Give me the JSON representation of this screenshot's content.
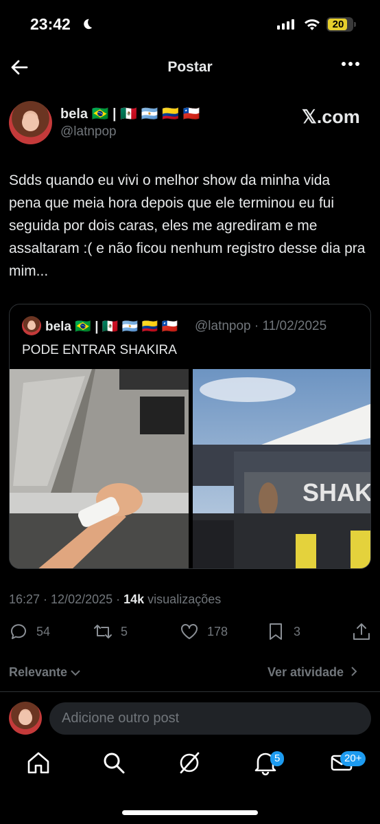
{
  "status_bar": {
    "time": "23:42",
    "battery": "20"
  },
  "header": {
    "title": "Postar"
  },
  "post": {
    "author_name": "bela 🇧🇷 | 🇲🇽 🇦🇷 🇨🇴 🇨🇱",
    "author_handle": "@latnpop",
    "source_badge": "𝕏.com",
    "text": "Sdds quando eu vivi o melhor show da minha vida pena que meia hora depois que ele terminou eu fui seguida por dois caras, eles me agrediram e me assaltaram :( e não ficou nenhum registro desse dia pra mim...",
    "timestamp": "16:27 · 12/02/2025 · ",
    "views_count": "14k",
    "views_label": " visualizações"
  },
  "quote": {
    "author_name": "bela 🇧🇷 | 🇲🇽 🇦🇷 🇨🇴 🇨🇱",
    "handle_date": "@latnpop · 11/02/2025",
    "text": "PODE ENTRAR SHAKIRA",
    "stage_sign": "SHAK"
  },
  "actions": {
    "replies": "54",
    "reposts": "5",
    "likes": "178",
    "bookmarks": "3"
  },
  "replies_bar": {
    "sort_label": "Relevante",
    "activity_label": "Ver atividade"
  },
  "reply_box": {
    "placeholder": "Adicione outro post"
  },
  "tabbar": {
    "notifications_badge": "5",
    "messages_badge": "20+"
  }
}
